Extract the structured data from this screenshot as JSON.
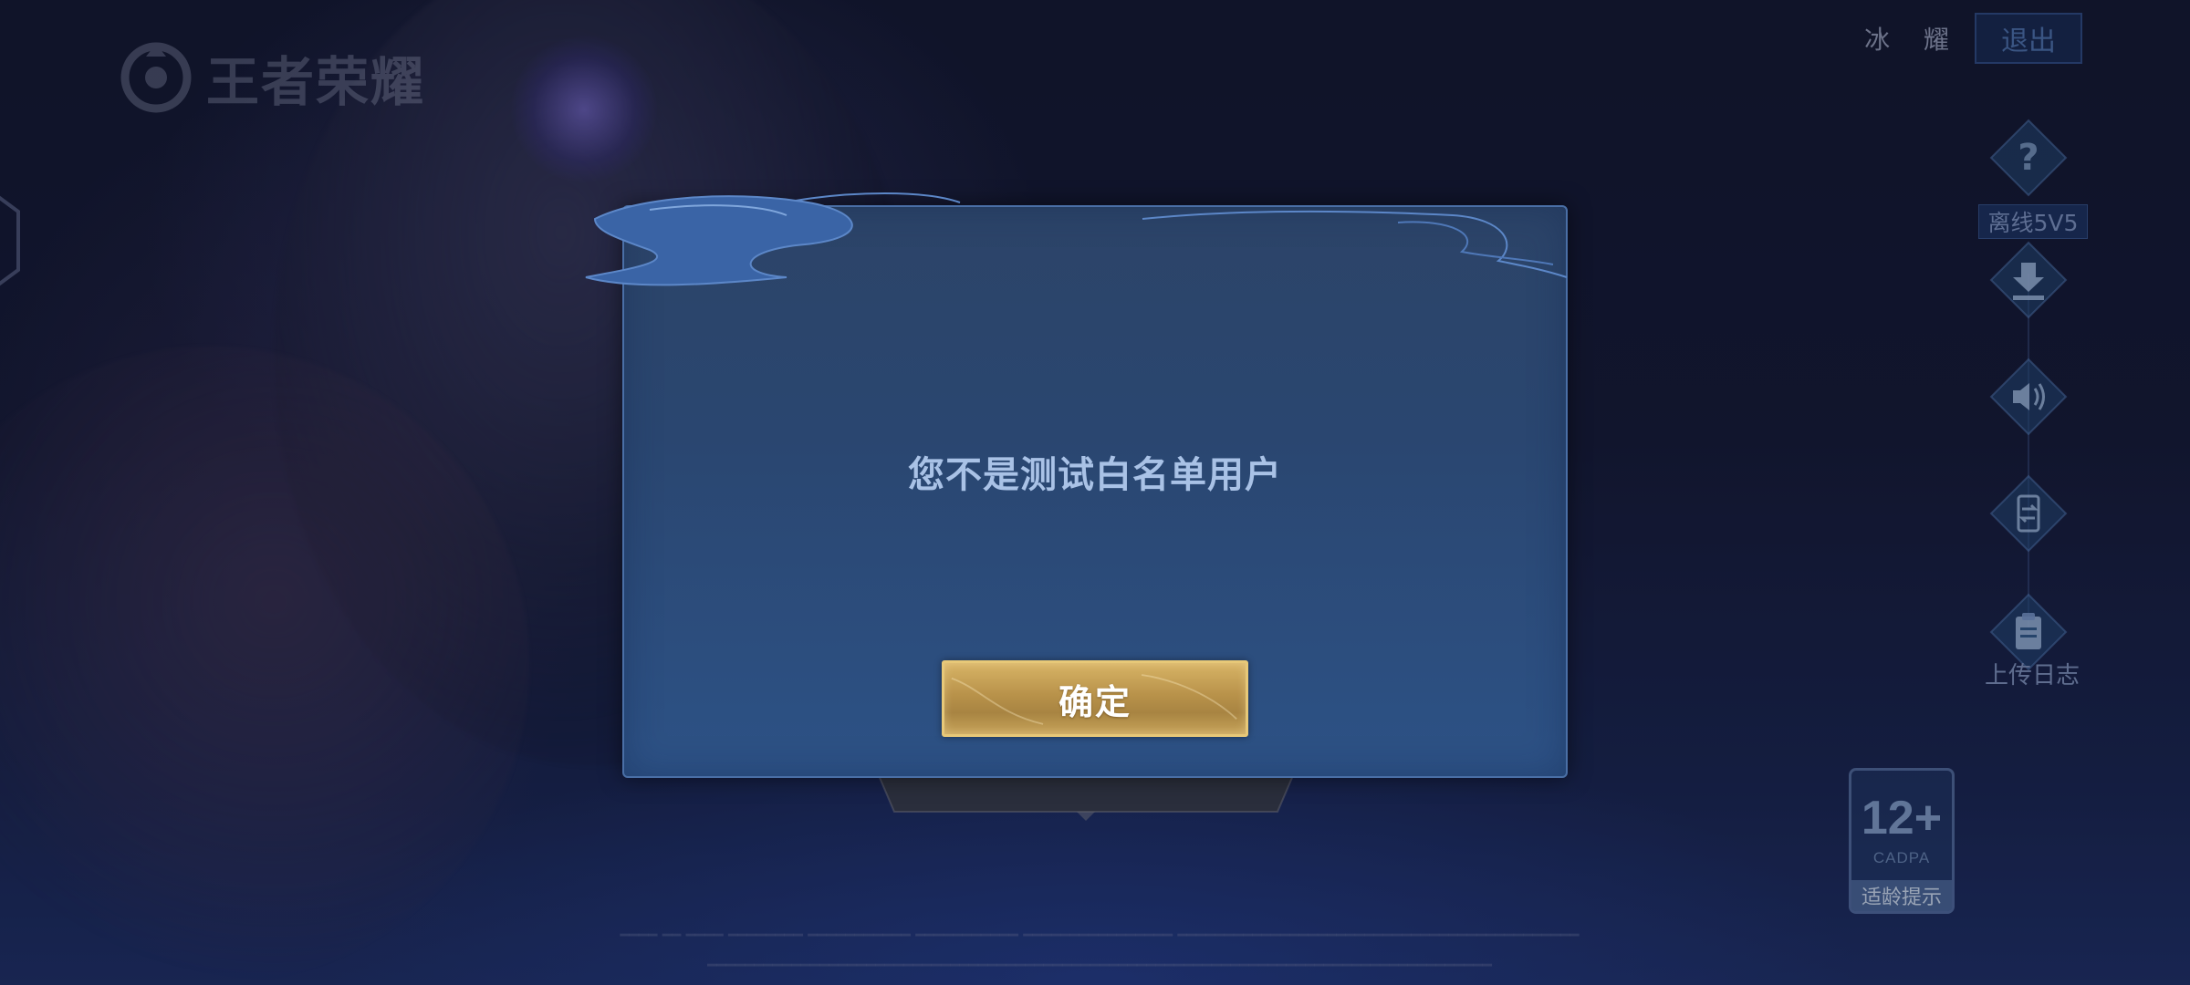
{
  "app": {
    "logo_text": "王者荣耀"
  },
  "header": {
    "username": "冰 耀",
    "exit_label": "退出"
  },
  "sidebar": {
    "items": [
      {
        "icon": "help-icon",
        "label": "离线5V5"
      },
      {
        "icon": "download-icon",
        "label": ""
      },
      {
        "icon": "speaker-icon",
        "label": ""
      },
      {
        "icon": "switch-account-icon",
        "label": ""
      },
      {
        "icon": "clipboard-icon",
        "label": "上传日志"
      }
    ]
  },
  "age_rating": {
    "age": "12+",
    "org": "CADPA",
    "tip": "适龄提示"
  },
  "dialog": {
    "message": "您不是测试白名单用户",
    "confirm_label": "确定"
  },
  "colors": {
    "dialog_bg": "#2a4670",
    "dialog_border": "#4a6fa6",
    "message_text": "#a9c2e6",
    "button_gold": "#c7a45a",
    "button_border": "#e7c878"
  }
}
